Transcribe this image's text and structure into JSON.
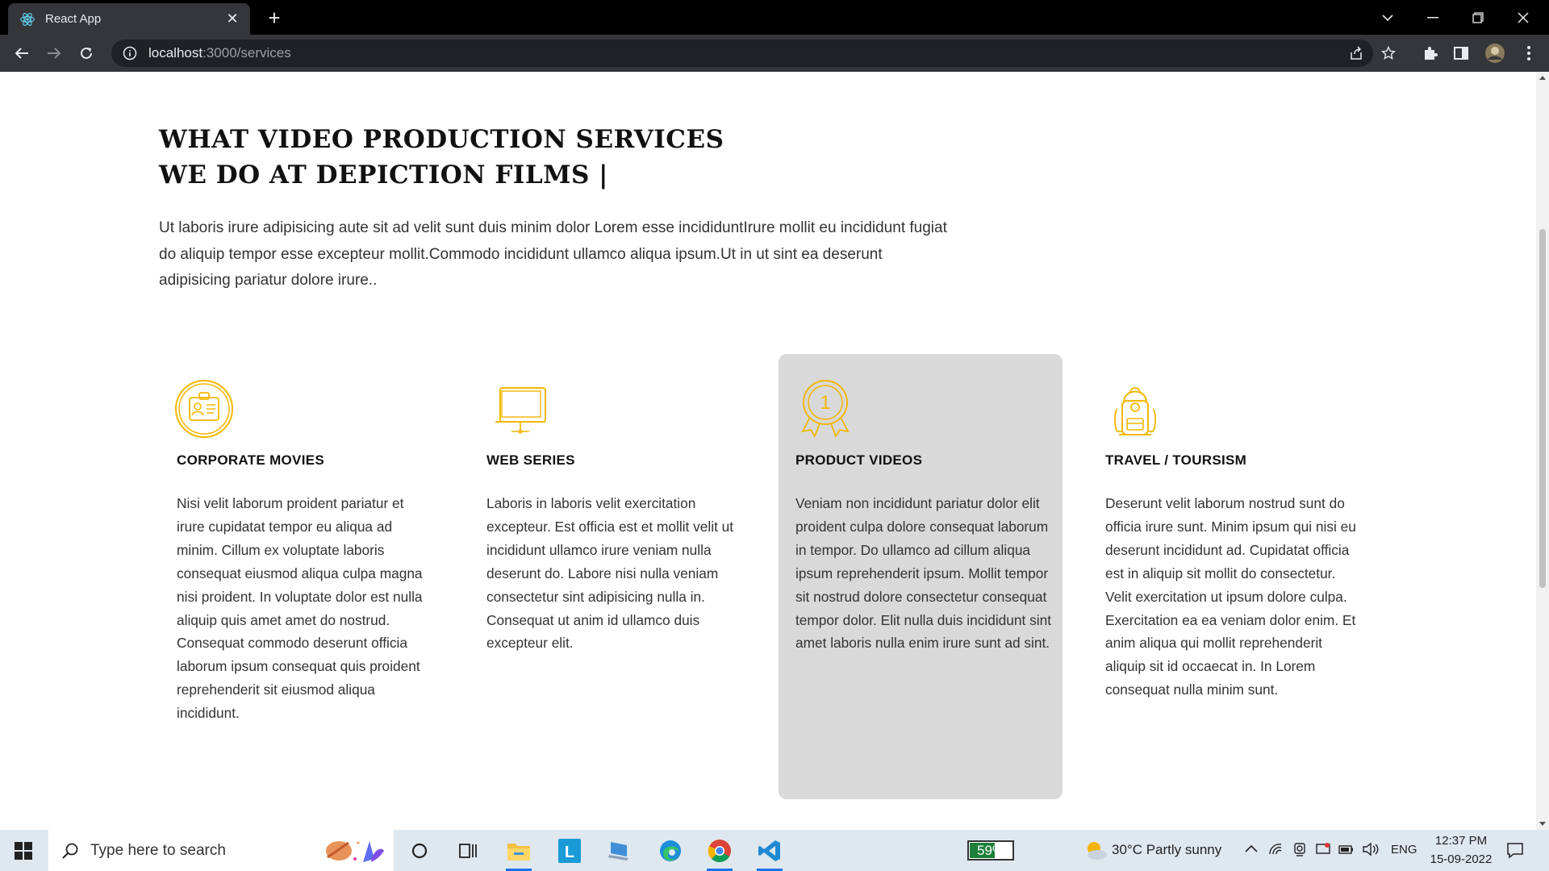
{
  "browser": {
    "tab_title": "React App",
    "url_host": "localhost",
    "url_path": ":3000/services"
  },
  "page": {
    "heading_line1": "WHAT VIDEO PRODUCTION SERVICES",
    "heading_line2": "WE DO AT DEPICTION FILMS |",
    "intro": "Ut laboris irure adipisicing aute sit ad velit sunt duis minim dolor Lorem esse incididuntIrure mollit eu incididunt fugiat do aliquip tempor esse excepteur mollit.Commodo incididunt ullamco aliqua ipsum.Ut in ut sint ea deserunt adipisicing pariatur dolore irure..",
    "services": [
      {
        "title": "CORPORATE MOVIES",
        "icon": "id-badge-icon",
        "text": "Nisi velit laborum proident pariatur et irure cupidatat tempor eu aliqua ad minim. Cillum ex voluptate laboris consequat eiusmod aliqua culpa magna nisi proident. In voluptate dolor est nulla aliquip quis amet amet do nostrud. Consequat commodo deserunt officia laborum ipsum consequat quis proident reprehenderit sit eiusmod aliqua incididunt."
      },
      {
        "title": "WEB SERIES",
        "icon": "monitor-icon",
        "text": "Laboris in laboris velit exercitation excepteur. Est officia est et mollit velit ut incididunt ullamco irure veniam nulla deserunt do. Labore nisi nulla veniam consectetur sint adipisicing nulla in. Consequat ut anim id ullamco duis excepteur elit."
      },
      {
        "title": "PRODUCT VIDEOS",
        "icon": "award-medal-icon",
        "medal_number": "1",
        "text": "Veniam non incididunt pariatur dolor elit proident culpa dolore consequat laborum in tempor. Do ullamco ad cillum aliqua ipsum reprehenderit ipsum. Mollit tempor sit nostrud dolore consectetur consequat tempor dolor. Elit nulla duis incididunt sint amet laboris nulla enim irure sunt ad sint."
      },
      {
        "title": "TRAVEL / TOURSISM",
        "icon": "backpack-icon",
        "text": "Deserunt velit laborum nostrud sunt do officia irure sunt. Minim ipsum qui nisi eu deserunt incididunt ad. Cupidatat officia est in aliquip sit mollit do consectetur. Velit exercitation ut ipsum dolore culpa. Exercitation ea ea veniam dolor enim. Et anim aliqua qui mollit reprehenderit aliquip sit id occaecat in. In Lorem consequat nulla minim sunt."
      }
    ],
    "icon_color": "#f2b705",
    "active_card_color": "#d9d9d9"
  },
  "taskbar": {
    "search_placeholder": "Type here to search",
    "battery_percent": "59%",
    "battery_level": 0.59,
    "weather": "30°C  Partly sunny",
    "language": "ENG",
    "time": "12:37 PM",
    "date": "15-09-2022"
  }
}
